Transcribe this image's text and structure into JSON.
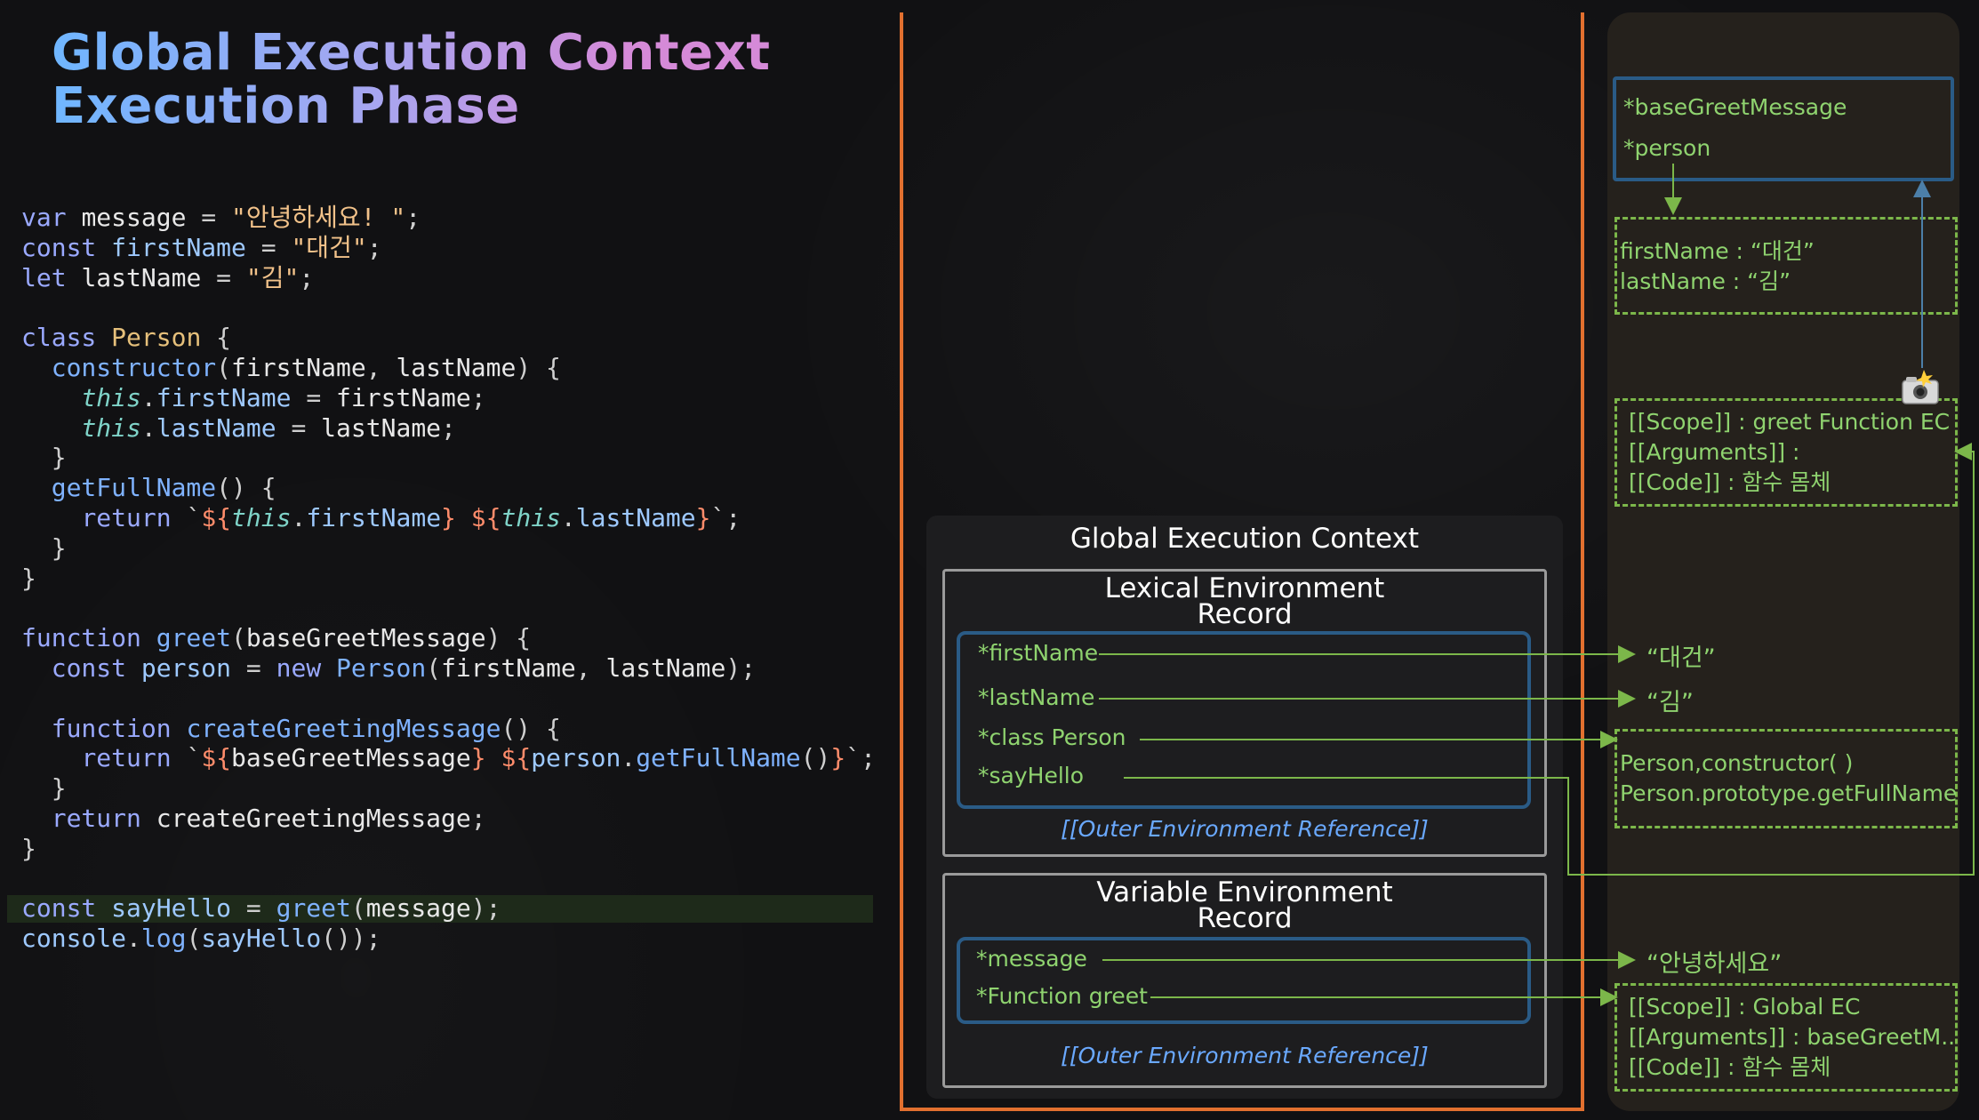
{
  "title": {
    "line1": "Global Execution Context",
    "line2": "Execution Phase"
  },
  "code_lines": [
    {
      "tokens": [
        [
          "kw",
          "var "
        ],
        [
          "id",
          "message "
        ],
        [
          "op",
          "= "
        ],
        [
          "str",
          "\"안녕하세요! \""
        ],
        [
          "op",
          ";"
        ]
      ]
    },
    {
      "tokens": [
        [
          "kw",
          "const "
        ],
        [
          "prop",
          "firstName "
        ],
        [
          "op",
          "= "
        ],
        [
          "str",
          "\"대건\""
        ],
        [
          "op",
          ";"
        ]
      ]
    },
    {
      "tokens": [
        [
          "kw",
          "let "
        ],
        [
          "id",
          "lastName "
        ],
        [
          "op",
          "= "
        ],
        [
          "str",
          "\"김\""
        ],
        [
          "op",
          ";"
        ]
      ]
    },
    {
      "tokens": []
    },
    {
      "tokens": [
        [
          "kw",
          "class "
        ],
        [
          "cls",
          "Person "
        ],
        [
          "op",
          "{"
        ]
      ]
    },
    {
      "tokens": [
        [
          "id",
          "  "
        ],
        [
          "fn",
          "constructor"
        ],
        [
          "op",
          "("
        ],
        [
          "id",
          "firstName"
        ],
        [
          "op",
          ", "
        ],
        [
          "id",
          "lastName"
        ],
        [
          "op",
          ") {"
        ]
      ]
    },
    {
      "tokens": [
        [
          "id",
          "    "
        ],
        [
          "this",
          "this"
        ],
        [
          "op",
          "."
        ],
        [
          "prop",
          "firstName "
        ],
        [
          "op",
          "= "
        ],
        [
          "id",
          "firstName"
        ],
        [
          "op",
          ";"
        ]
      ]
    },
    {
      "tokens": [
        [
          "id",
          "    "
        ],
        [
          "this",
          "this"
        ],
        [
          "op",
          "."
        ],
        [
          "prop",
          "lastName "
        ],
        [
          "op",
          "= "
        ],
        [
          "id",
          "lastName"
        ],
        [
          "op",
          ";"
        ]
      ]
    },
    {
      "tokens": [
        [
          "op",
          "  }"
        ]
      ]
    },
    {
      "tokens": [
        [
          "id",
          "  "
        ],
        [
          "fn",
          "getFullName"
        ],
        [
          "op",
          "() {"
        ]
      ]
    },
    {
      "tokens": [
        [
          "id",
          "    "
        ],
        [
          "kw",
          "return "
        ],
        [
          "op",
          "`"
        ],
        [
          "tpl",
          "${"
        ],
        [
          "this",
          "this"
        ],
        [
          "op",
          "."
        ],
        [
          "prop",
          "firstName"
        ],
        [
          "tpl",
          "}"
        ],
        [
          "op",
          " "
        ],
        [
          "tpl",
          "${"
        ],
        [
          "this",
          "this"
        ],
        [
          "op",
          "."
        ],
        [
          "prop",
          "lastName"
        ],
        [
          "tpl",
          "}"
        ],
        [
          "op",
          "`;"
        ]
      ]
    },
    {
      "tokens": [
        [
          "op",
          "  }"
        ]
      ]
    },
    {
      "tokens": [
        [
          "op",
          "}"
        ]
      ]
    },
    {
      "tokens": []
    },
    {
      "tokens": [
        [
          "kw",
          "function "
        ],
        [
          "fn",
          "greet"
        ],
        [
          "op",
          "("
        ],
        [
          "id",
          "baseGreetMessage"
        ],
        [
          "op",
          ") {"
        ]
      ]
    },
    {
      "tokens": [
        [
          "id",
          "  "
        ],
        [
          "kw",
          "const "
        ],
        [
          "prop",
          "person "
        ],
        [
          "op",
          "= "
        ],
        [
          "kw",
          "new "
        ],
        [
          "fn",
          "Person"
        ],
        [
          "op",
          "("
        ],
        [
          "id",
          "firstName"
        ],
        [
          "op",
          ", "
        ],
        [
          "id",
          "lastName"
        ],
        [
          "op",
          ");"
        ]
      ]
    },
    {
      "tokens": []
    },
    {
      "tokens": [
        [
          "id",
          "  "
        ],
        [
          "kw",
          "function "
        ],
        [
          "fn",
          "createGreetingMessage"
        ],
        [
          "op",
          "() {"
        ]
      ]
    },
    {
      "tokens": [
        [
          "id",
          "    "
        ],
        [
          "kw",
          "return "
        ],
        [
          "op",
          "`"
        ],
        [
          "tpl",
          "${"
        ],
        [
          "id",
          "baseGreetMessage"
        ],
        [
          "tpl",
          "}"
        ],
        [
          "op",
          " "
        ],
        [
          "tpl",
          "${"
        ],
        [
          "prop",
          "person"
        ],
        [
          "op",
          "."
        ],
        [
          "fn",
          "getFullName"
        ],
        [
          "op",
          "()"
        ],
        [
          "tpl",
          "}"
        ],
        [
          "op",
          "`;"
        ]
      ]
    },
    {
      "tokens": [
        [
          "op",
          "  }"
        ]
      ]
    },
    {
      "tokens": [
        [
          "id",
          "  "
        ],
        [
          "kw",
          "return "
        ],
        [
          "id",
          "createGreetingMessage"
        ],
        [
          "op",
          ";"
        ]
      ]
    },
    {
      "tokens": [
        [
          "op",
          "}"
        ]
      ]
    },
    {
      "tokens": []
    },
    {
      "highlight": true,
      "tokens": [
        [
          "kw",
          "const "
        ],
        [
          "prop",
          "sayHello "
        ],
        [
          "op",
          "= "
        ],
        [
          "fn",
          "greet"
        ],
        [
          "op",
          "("
        ],
        [
          "id",
          "message"
        ],
        [
          "op",
          ");"
        ]
      ]
    },
    {
      "tokens": [
        [
          "prop",
          "console"
        ],
        [
          "op",
          "."
        ],
        [
          "fn",
          "log"
        ],
        [
          "op",
          "("
        ],
        [
          "prop",
          "sayHello"
        ],
        [
          "op",
          "());"
        ]
      ]
    }
  ],
  "gec": {
    "title": "Global Execution Context",
    "lexical": {
      "title_line1": "Lexical Environment",
      "title_line2": "Record",
      "items": [
        "*firstName",
        "*lastName",
        "*class Person",
        "*sayHello"
      ],
      "outer_ref": "[[Outer Environment Reference]]"
    },
    "variable": {
      "title_line1": "Variable Environment",
      "title_line2": "Record",
      "items": [
        "*message",
        "*Function greet"
      ],
      "outer_ref": "[[Outer Environment Reference]]"
    }
  },
  "values": {
    "firstName": "“대건”",
    "lastName": "“김”",
    "message": "“안녕하세요”"
  },
  "heap": {
    "greet_env": {
      "line1": "*baseGreetMessage",
      "line2": "*person"
    },
    "person_obj": {
      "line1": "firstName : “대건”",
      "line2": "lastName : “김”"
    },
    "create_fn": {
      "line1": "[[Scope]]  : greet Function EC",
      "line2": "[[Arguments]] :",
      "line3": "[[Code]] : 함수 몸체"
    },
    "person_class": {
      "line1": "Person,constructor( )",
      "line2": "Person.prototype.getFullName"
    },
    "greet_fn": {
      "line1": "[[Scope]]  : Global EC",
      "line2": "[[Arguments]] : baseGreetM..",
      "line3": "[[Code]] : 함수 몸체"
    }
  },
  "colors": {
    "frame": "#e2702f",
    "arrow_green": "#7cb74a",
    "arrow_blue": "#4c7fa8",
    "record_border": "#2a5b86"
  },
  "icons": {
    "snapshot": "camera-flash-icon"
  }
}
